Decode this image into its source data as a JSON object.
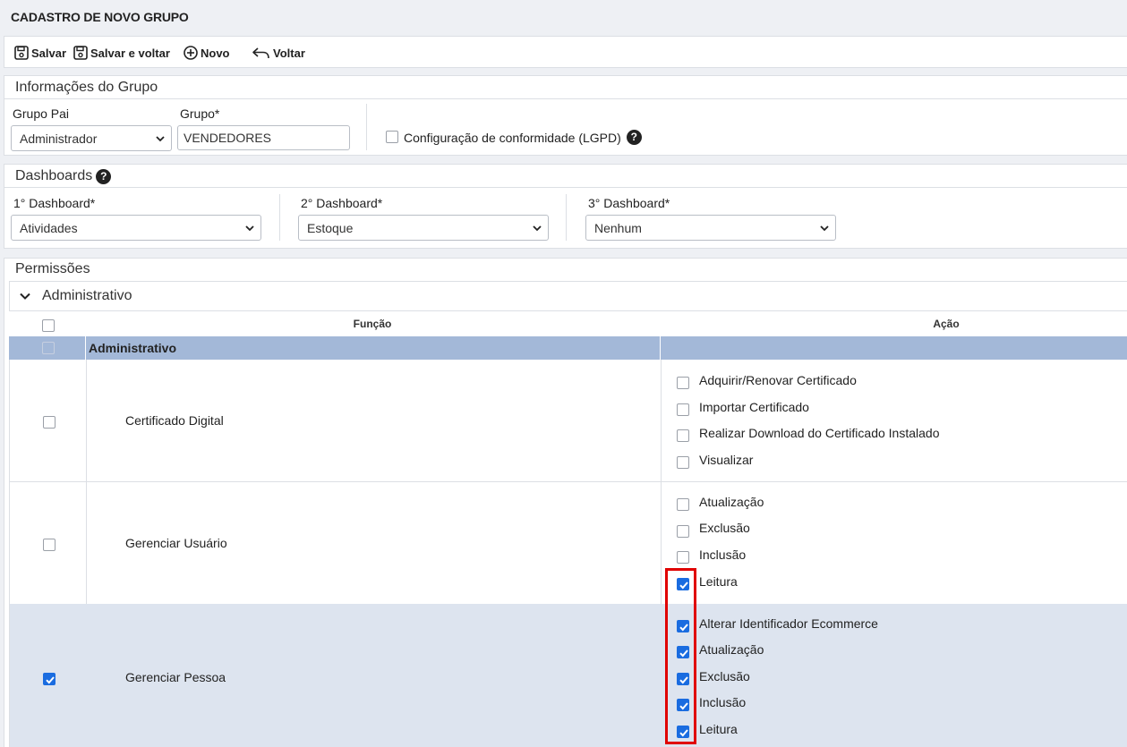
{
  "page": {
    "title": "CADASTRO DE NOVO GRUPO"
  },
  "toolbar": {
    "save": "Salvar",
    "save_back": "Salvar e voltar",
    "new": "Novo",
    "back": "Voltar"
  },
  "group_info": {
    "title": "Informações do Grupo",
    "parent_label": "Grupo Pai",
    "parent_value": "Administrador",
    "group_label": "Grupo*",
    "group_value": "VENDEDORES",
    "lgpd_label": "Configuração de conformidade (LGPD)",
    "lgpd_checked": false
  },
  "dashboards": {
    "title": "Dashboards",
    "d1_label": "1° Dashboard*",
    "d1_value": "Atividades",
    "d2_label": "2° Dashboard*",
    "d2_value": "Estoque",
    "d3_label": "3° Dashboard*",
    "d3_value": "Nenhum"
  },
  "permissions": {
    "title": "Permissões",
    "accordion": "Administrativo",
    "col_function": "Função",
    "col_action": "Ação",
    "group": "Administrativo",
    "rows": [
      {
        "function": "Certificado Digital",
        "checked": false,
        "actions": [
          {
            "label": "Adquirir/Renovar Certificado",
            "checked": false
          },
          {
            "label": "Importar Certificado",
            "checked": false
          },
          {
            "label": "Realizar Download do Certificado Instalado",
            "checked": false
          },
          {
            "label": "Visualizar",
            "checked": false
          }
        ]
      },
      {
        "function": "Gerenciar Usuário",
        "checked": false,
        "actions": [
          {
            "label": "Atualização",
            "checked": false
          },
          {
            "label": "Exclusão",
            "checked": false
          },
          {
            "label": "Inclusão",
            "checked": false
          },
          {
            "label": "Leitura",
            "checked": true
          }
        ]
      },
      {
        "function": "Gerenciar Pessoa",
        "checked": true,
        "actions": [
          {
            "label": "Alterar Identificador Ecommerce",
            "checked": true
          },
          {
            "label": "Atualização",
            "checked": true
          },
          {
            "label": "Exclusão",
            "checked": true
          },
          {
            "label": "Inclusão",
            "checked": true
          },
          {
            "label": "Leitura",
            "checked": true
          }
        ]
      }
    ]
  },
  "colors": {
    "accent": "#1a6ce0",
    "group_row": "#a3b8d8",
    "selected_row": "#dde4ef",
    "highlight": "#e00000"
  }
}
